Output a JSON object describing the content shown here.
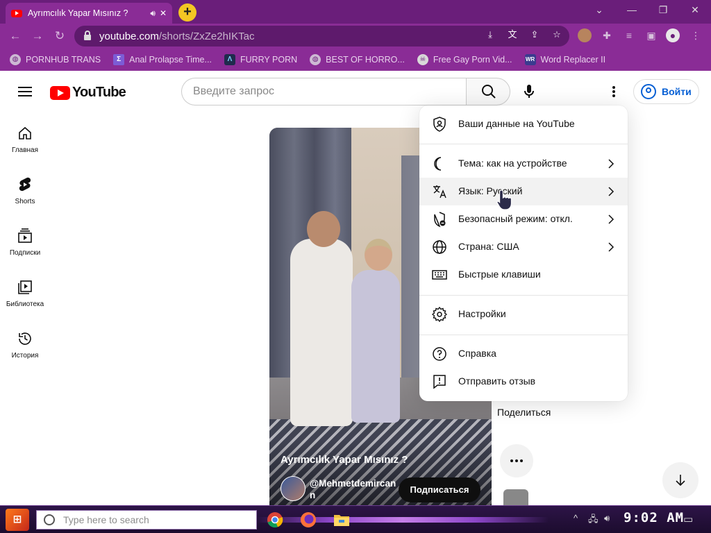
{
  "browser": {
    "tab": {
      "title": "Ayrımcılık Yapar Mısınız ?"
    },
    "url": {
      "host": "youtube.com",
      "path": "/shorts/ZxZe2hIKTac"
    },
    "bookmarks": [
      {
        "label": "PORNHUB TRANS",
        "icon": "globe-icon"
      },
      {
        "label": "Anal Prolapse Time...",
        "icon": "bookmark-icon"
      },
      {
        "label": "FURRY PORN",
        "icon": "lambda-icon"
      },
      {
        "label": "BEST OF HORRO...",
        "icon": "globe-icon"
      },
      {
        "label": "Free Gay Porn Vid...",
        "icon": "skull-icon"
      },
      {
        "label": "Word Replacer II",
        "icon": "wr-icon"
      }
    ]
  },
  "youtube": {
    "logo_text": "YouTube",
    "search_placeholder": "Введите запрос",
    "signin_label": "Войти",
    "sidebar": [
      {
        "label": "Главная",
        "icon": "home-icon"
      },
      {
        "label": "Shorts",
        "icon": "shorts-icon"
      },
      {
        "label": "Подписки",
        "icon": "subscriptions-icon"
      },
      {
        "label": "Библиотека",
        "icon": "library-icon"
      },
      {
        "label": "История",
        "icon": "history-icon"
      }
    ],
    "video": {
      "title": "Ayrımcılık Yapar Mısınız ?",
      "channel": "@Mehmetdemircann",
      "subscribe_label": "Подписаться"
    },
    "share_label": "Поделиться",
    "menu": [
      {
        "label": "Ваши данные на YouTube",
        "icon": "shield-person-icon",
        "chevron": false
      },
      {
        "label": "Тема: как на устройстве",
        "icon": "moon-icon",
        "chevron": true
      },
      {
        "label": "Язык: Русский",
        "icon": "translate-icon",
        "chevron": true
      },
      {
        "label": "Безопасный режим: откл.",
        "icon": "shield-lock-icon",
        "chevron": true
      },
      {
        "label": "Страна: США",
        "icon": "globe-icon",
        "chevron": true
      },
      {
        "label": "Быстрые клавиши",
        "icon": "keyboard-icon",
        "chevron": false
      },
      {
        "label": "Настройки",
        "icon": "gear-icon",
        "chevron": false
      },
      {
        "label": "Справка",
        "icon": "help-icon",
        "chevron": false
      },
      {
        "label": "Отправить отзыв",
        "icon": "feedback-icon",
        "chevron": false
      }
    ]
  },
  "taskbar": {
    "search_placeholder": "Type here to search",
    "clock": "9:02 AM"
  },
  "colors": {
    "browser_frame": "#8a2c96",
    "youtube_red": "#ff0000",
    "link_blue": "#065fd4",
    "taskbar": "#2d1447"
  }
}
